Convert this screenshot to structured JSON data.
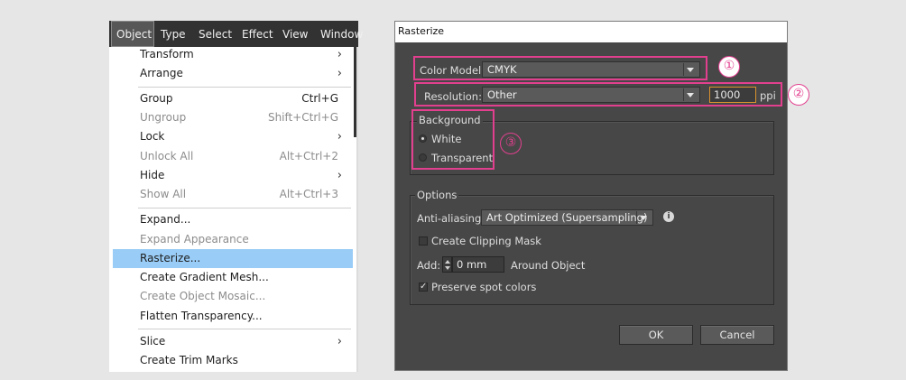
{
  "menubar": {
    "items": [
      "Object",
      "Type",
      "Select",
      "Effect",
      "View",
      "Window"
    ]
  },
  "menu": {
    "transform": "Transform",
    "arrange": "Arrange",
    "group": "Group",
    "group_sc": "Ctrl+G",
    "ungroup": "Ungroup",
    "ungroup_sc": "Shift+Ctrl+G",
    "lock": "Lock",
    "unlock_all": "Unlock All",
    "unlock_all_sc": "Alt+Ctrl+2",
    "hide": "Hide",
    "show_all": "Show All",
    "show_all_sc": "Alt+Ctrl+3",
    "expand": "Expand...",
    "expand_appearance": "Expand Appearance",
    "rasterize": "Rasterize...",
    "create_gradient_mesh": "Create Gradient Mesh...",
    "create_object_mosaic": "Create Object Mosaic...",
    "flatten_transparency": "Flatten Transparency...",
    "slice": "Slice",
    "create_trim_marks": "Create Trim Marks",
    "arrow": "›"
  },
  "dialog": {
    "title": "Rasterize",
    "color_model_label": "Color Model:",
    "color_model_value": "CMYK",
    "resolution_label": "Resolution:",
    "resolution_value": "Other",
    "ppi_value": "1000",
    "ppi_unit": "ppi",
    "background_label": "Background",
    "white_label": "White",
    "transparent_label": "Transparent",
    "options_label": "Options",
    "anti_aliasing_label": "Anti-aliasing:",
    "anti_aliasing_value": "Art Optimized (Supersampling)",
    "clipping_mask_label": "Create Clipping Mask",
    "add_label": "Add:",
    "add_value": "0 mm",
    "around_object_label": "Around Object",
    "preserve_spot_label": "Preserve spot colors",
    "ok_label": "OK",
    "cancel_label": "Cancel",
    "info_glyph": "i",
    "check_glyph": "✓"
  },
  "callouts": {
    "one": "①",
    "two": "②",
    "three": "③"
  },
  "colors": {
    "highlight": "#e2408f",
    "menu_selection": "#99ccf6",
    "dialog_bg": "#474747"
  }
}
